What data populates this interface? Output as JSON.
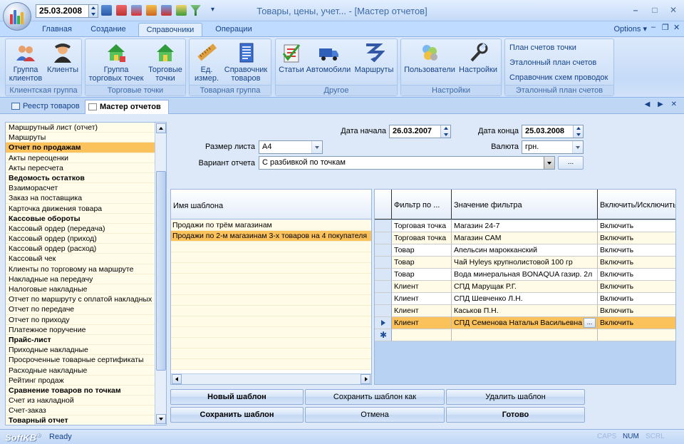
{
  "titlebar": {
    "date": "25.03.2008",
    "title": "Товары, цены, учет... - [Мастер отчетов]",
    "qat_more": "▾",
    "min": "–",
    "max": "□",
    "close": "✕",
    "qat_icons": [
      "table-icon",
      "refresh-icon",
      "export-icon",
      "report-icon",
      "print-icon",
      "check-icon",
      "filter-icon"
    ]
  },
  "ribbon_tabs": [
    {
      "label": "Главная"
    },
    {
      "label": "Создание"
    },
    {
      "label": "Справочники"
    },
    {
      "label": "Операции"
    }
  ],
  "ribbon_active_tab": "Справочники",
  "options_label": "Options ▾",
  "tab_controls": [
    "–",
    "❐",
    "✕"
  ],
  "ribbon_groups": [
    {
      "caption": "Клиентская группа",
      "buttons": [
        "Группа клиентов",
        "Клиенты"
      ]
    },
    {
      "caption": "Торговые точки",
      "buttons": [
        "Группа торговых точек",
        "Торговые точки"
      ]
    },
    {
      "caption": "Товарная группа",
      "buttons": [
        "Ед. измер.",
        "Справочник товаров"
      ]
    },
    {
      "caption": "Другое",
      "buttons": [
        "Статьи",
        "Автомобили",
        "Маршруты"
      ]
    },
    {
      "caption": "Настройки",
      "buttons": [
        "Пользователи",
        "Настройки"
      ]
    },
    {
      "caption": "Эталонный план счетов",
      "links": [
        "План счетов точки",
        "Эталонный план счетов",
        "Справочник схем проводок"
      ]
    }
  ],
  "doc_tabs": [
    {
      "label": "Реестр товаров",
      "active": false
    },
    {
      "label": "Мастер отчетов",
      "active": true
    }
  ],
  "nav_arrows": "◀ ▶ ✕",
  "report_list": {
    "selected": "Отчет по продажам",
    "items": [
      {
        "label": "Маршрутный лист (отчет)",
        "bold": false
      },
      {
        "label": "Маршруты",
        "bold": false
      },
      {
        "label": "Отчет по продажам",
        "bold": true
      },
      {
        "label": "Акты переоценки",
        "bold": false
      },
      {
        "label": "Акты пересчета",
        "bold": false
      },
      {
        "label": "Ведомость остатков",
        "bold": true
      },
      {
        "label": "Взаиморасчет",
        "bold": false
      },
      {
        "label": "Заказ на поставщика",
        "bold": false
      },
      {
        "label": "Карточка движения товара",
        "bold": false
      },
      {
        "label": "Кассовые обороты",
        "bold": true
      },
      {
        "label": "Кассовый ордер (передача)",
        "bold": false
      },
      {
        "label": "Кассовый ордер (приход)",
        "bold": false
      },
      {
        "label": "Кассовый ордер (расход)",
        "bold": false
      },
      {
        "label": "Кассовый чек",
        "bold": false
      },
      {
        "label": "Клиенты по торговому на маршруте",
        "bold": false
      },
      {
        "label": "Накладные на передачу",
        "bold": false
      },
      {
        "label": "Налоговые накладные",
        "bold": false
      },
      {
        "label": "Отчет по маршруту с оплатой накладных",
        "bold": false
      },
      {
        "label": "Отчет по передаче",
        "bold": false
      },
      {
        "label": "Отчет по приходу",
        "bold": false
      },
      {
        "label": "Платежное поручение",
        "bold": false
      },
      {
        "label": "Прайс-лист",
        "bold": true
      },
      {
        "label": "Приходные накладные",
        "bold": false
      },
      {
        "label": "Просроченные товарные сертификаты",
        "bold": false
      },
      {
        "label": "Расходные накладные",
        "bold": false
      },
      {
        "label": "Рейтинг продаж",
        "bold": false
      },
      {
        "label": "Сравнение товаров по точкам",
        "bold": true
      },
      {
        "label": "Счет из накладной",
        "bold": false
      },
      {
        "label": "Счет-заказ",
        "bold": false
      },
      {
        "label": "Товарный отчет",
        "bold": true
      }
    ]
  },
  "form": {
    "date_start_label": "Дата начала",
    "date_start": "26.03.2007",
    "date_end_label": "Дата конца",
    "date_end": "25.03.2008",
    "sheet_size_label": "Размер листа",
    "sheet_size": "A4",
    "currency_label": "Валюта",
    "currency": "грн.",
    "variant_label": "Вариант отчета",
    "variant": "С разбивкой по точкам",
    "variant_more": "..."
  },
  "templates": {
    "header": "Имя шаблона",
    "rows": [
      {
        "name": "Продажи по трём магазинам",
        "selected": false
      },
      {
        "name": "Продажи по 2-м магазинам 3-х товаров на 4 покупателя",
        "selected": true
      }
    ]
  },
  "filters": {
    "headers": [
      "Фильтр по ...",
      "Значение фильтра",
      "Включить/Исключить"
    ],
    "rows": [
      {
        "filter": "Торговая точка",
        "value": "Магазин 24-7",
        "mode": "Включить"
      },
      {
        "filter": "Торговая точка",
        "value": "Магазин САМ",
        "mode": "Включить"
      },
      {
        "filter": "Товар",
        "value": "Апельсин марокканский",
        "mode": "Включить"
      },
      {
        "filter": "Товар",
        "value": "Чай Hyleys крупнолистовой 100 гр",
        "mode": "Включить"
      },
      {
        "filter": "Товар",
        "value": "Вода минеральная BONAQUA газир. 2л",
        "mode": "Включить"
      },
      {
        "filter": "Клиент",
        "value": "СПД Марущак Р.Г.",
        "mode": "Включить"
      },
      {
        "filter": "Клиент",
        "value": "СПД Шевченко Л.Н.",
        "mode": "Включить"
      },
      {
        "filter": "Клиент",
        "value": "Каськов П.Н.",
        "mode": "Включить"
      },
      {
        "filter": "Клиент",
        "value": "СПД Семенова Наталья Васильевна",
        "mode": "Включить"
      }
    ],
    "selected_index": 8,
    "cell_more": "...",
    "new_row_marker": "✱"
  },
  "buttons": {
    "new_template": "Новый шаблон",
    "save_as": "Сохранить шаблон как",
    "delete": "Удалить шаблон",
    "save": "Сохранить шаблон",
    "cancel": "Отмена",
    "done": "Готово"
  },
  "statusbar": {
    "logo": "SoftKB",
    "logo_mark": "®",
    "ready": "Ready",
    "caps": "CAPS",
    "num": "NUM",
    "scrl": "SCRL"
  },
  "colors": {
    "selection": "#fbc25b",
    "ribbon_text": "#15428b",
    "row_alt": "#fffbe7"
  }
}
